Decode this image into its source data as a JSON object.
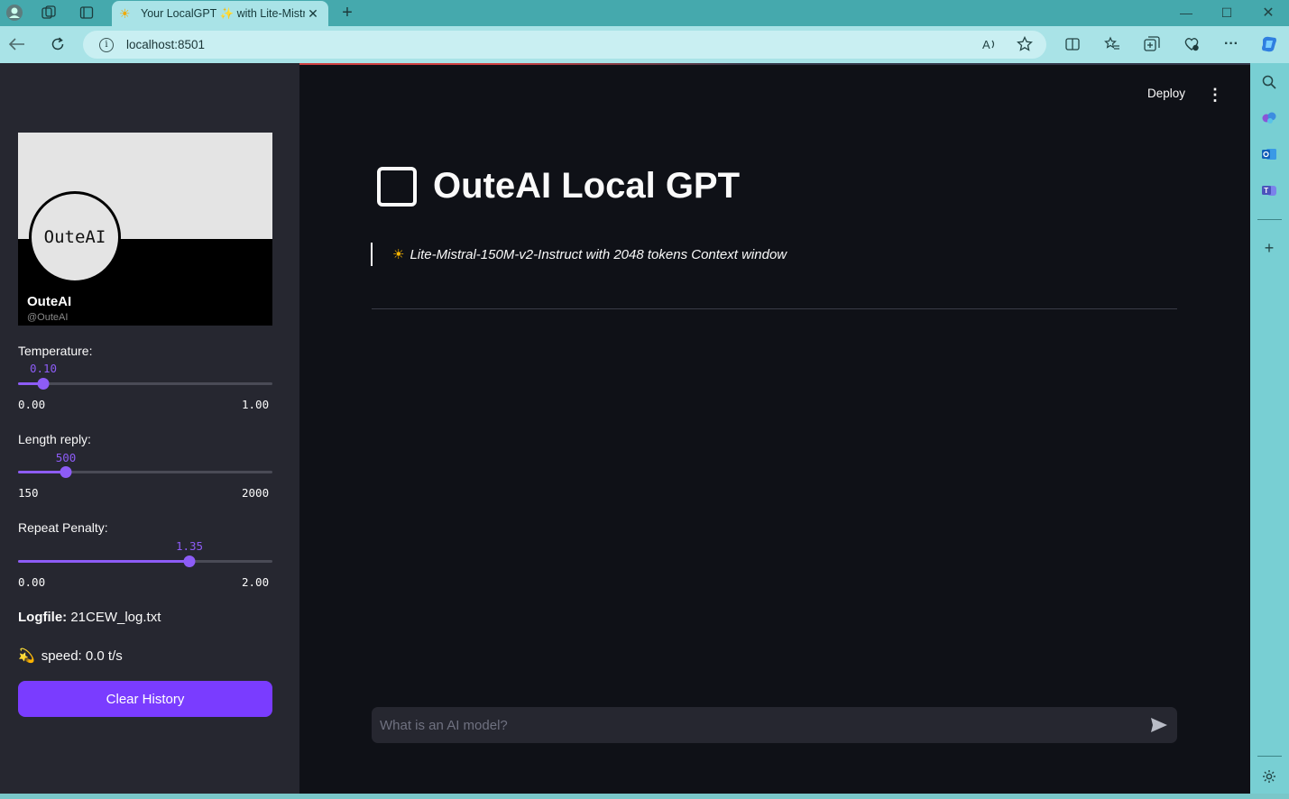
{
  "browser": {
    "tab_title": "Your LocalGPT ✨ with Lite-Mistr",
    "tab_favicon": "sun-icon",
    "url": "localhost:8501",
    "accent_color": "#45a9ad"
  },
  "header": {
    "deploy_label": "Deploy",
    "menu_icon": "kebab-icon"
  },
  "sidebar": {
    "banner": {
      "logo_text": "OuteAI",
      "name": "OuteAI",
      "handle": "@OuteAI"
    },
    "temperature": {
      "label": "Temperature:",
      "value": "0.10",
      "min": "0.00",
      "max": "1.00",
      "fraction": 0.1
    },
    "length_reply": {
      "label": "Length reply:",
      "value": "500",
      "min": "150",
      "max": "2000",
      "fraction": 0.19
    },
    "repeat_penalty": {
      "label": "Repeat Penalty:",
      "value": "1.35",
      "min": "0.00",
      "max": "2.00",
      "fraction": 0.675
    },
    "logfile_label": "Logfile:",
    "logfile_value": "21CEW_log.txt",
    "speed_text": "speed: 0.0 t/s",
    "clear_label": "Clear History",
    "accent_color": "#8d5cf6"
  },
  "main": {
    "title": "OuteAI Local GPT",
    "subtitle": "Lite-Mistral-150M-v2-Instruct with 2048 tokens Context window",
    "chat_placeholder": "What is an AI model?"
  }
}
